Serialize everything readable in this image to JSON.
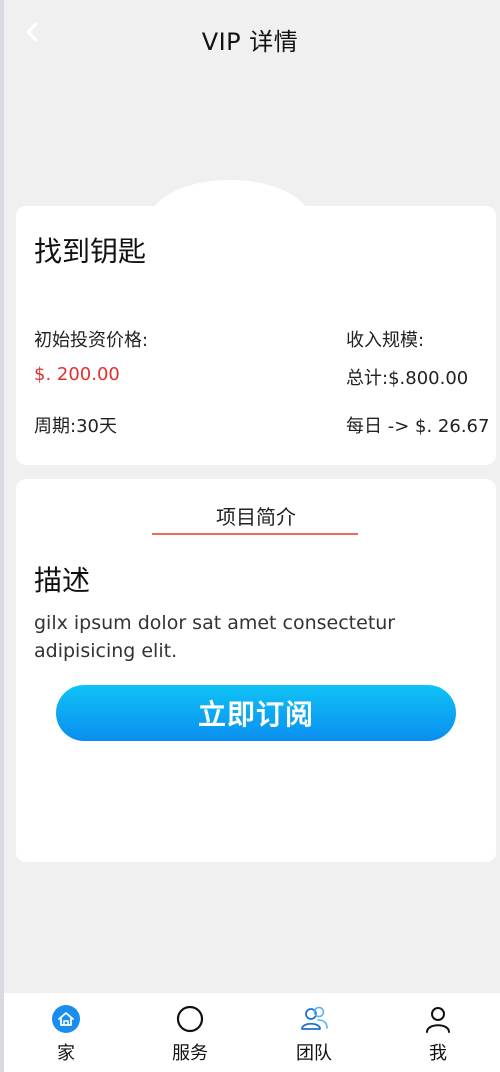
{
  "header": {
    "title": "VIP 详情"
  },
  "plan": {
    "name": "找到钥匙",
    "initial_investment_label": "初始投资价格:",
    "initial_investment_value": "$. 200.00",
    "period_label": "周期:30天",
    "income_scale_label": "收入规模:",
    "total_label": "总计:$.800.00",
    "daily_label": "每日 -> $. 26.67"
  },
  "intro": {
    "section_title": "项目简介",
    "desc_title": "描述",
    "desc_body": "gilx ipsum dolor sat amet consectetur adipisicing elit.",
    "subscribe_label": "立即订阅"
  },
  "tabbar": {
    "items": [
      {
        "label": "家",
        "icon": "home-icon"
      },
      {
        "label": "服务",
        "icon": "circle-icon"
      },
      {
        "label": "团队",
        "icon": "team-icon"
      },
      {
        "label": "我",
        "icon": "user-icon"
      }
    ]
  },
  "colors": {
    "price": "#e0312f",
    "accent": "#1a8ef0",
    "underline": "#ef6a5e"
  }
}
